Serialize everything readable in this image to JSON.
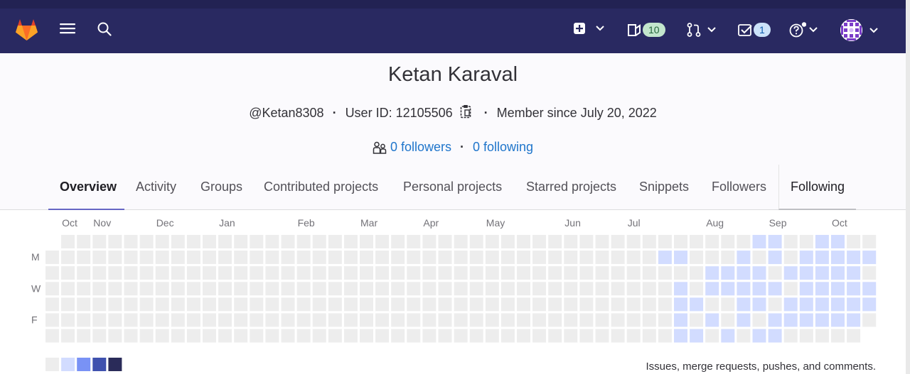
{
  "nav": {
    "todos_count": "10",
    "mr_count": "1"
  },
  "profile": {
    "name": "Ketan Karaval",
    "username": "@Ketan8308",
    "user_id": "User ID: 12105506",
    "member_since": "Member since July 20, 2022",
    "followers": "0 followers",
    "following": "0 following"
  },
  "tabs": [
    {
      "label": "Overview",
      "active": true
    },
    {
      "label": "Activity"
    },
    {
      "label": "Groups"
    },
    {
      "label": "Contributed projects"
    },
    {
      "label": "Personal projects"
    },
    {
      "label": "Starred projects"
    },
    {
      "label": "Snippets"
    },
    {
      "label": "Followers"
    },
    {
      "label": "Following"
    }
  ],
  "calendar": {
    "months": [
      "Oct",
      "Nov",
      "Dec",
      "Jan",
      "Feb",
      "Mar",
      "Apr",
      "May",
      "Jun",
      "Jul",
      "Aug",
      "Sep",
      "Oct"
    ],
    "day_labels": [
      "M",
      "W",
      "F"
    ],
    "caption": "Issues, merge requests, pushes, and comments.",
    "colors": {
      "empty": "#ededed",
      "level1": "#d2dcff",
      "level2": "#7992f5",
      "level3": "#3f51ae",
      "level4": "#2a2b59"
    },
    "legend_colors": [
      "#ededed",
      "#d2dcff",
      "#7992f5",
      "#3f51ae",
      "#2a2b59"
    ],
    "active_cells": [
      [
        39,
        1
      ],
      [
        40,
        1
      ],
      [
        40,
        3
      ],
      [
        40,
        4
      ],
      [
        40,
        5
      ],
      [
        40,
        6
      ],
      [
        41,
        4
      ],
      [
        41,
        6
      ],
      [
        42,
        2
      ],
      [
        42,
        3
      ],
      [
        42,
        5
      ],
      [
        43,
        2
      ],
      [
        43,
        3
      ],
      [
        43,
        6
      ],
      [
        44,
        1
      ],
      [
        44,
        2
      ],
      [
        44,
        3
      ],
      [
        44,
        4
      ],
      [
        44,
        5
      ],
      [
        45,
        0
      ],
      [
        45,
        2
      ],
      [
        45,
        3
      ],
      [
        45,
        4
      ],
      [
        45,
        6
      ],
      [
        46,
        0
      ],
      [
        46,
        1
      ],
      [
        46,
        3
      ],
      [
        46,
        5
      ],
      [
        46,
        6
      ],
      [
        47,
        2
      ],
      [
        47,
        4
      ],
      [
        47,
        5
      ],
      [
        48,
        1
      ],
      [
        48,
        2
      ],
      [
        48,
        3
      ],
      [
        48,
        4
      ],
      [
        48,
        5
      ],
      [
        49,
        0
      ],
      [
        49,
        1
      ],
      [
        49,
        2
      ],
      [
        49,
        3
      ],
      [
        49,
        4
      ],
      [
        49,
        5
      ],
      [
        50,
        0
      ],
      [
        50,
        1
      ],
      [
        50,
        2
      ],
      [
        50,
        3
      ],
      [
        50,
        4
      ],
      [
        50,
        5
      ],
      [
        51,
        1
      ],
      [
        51,
        2
      ],
      [
        51,
        3
      ],
      [
        51,
        4
      ],
      [
        51,
        5
      ],
      [
        52,
        1
      ],
      [
        52,
        3
      ],
      [
        52,
        4
      ],
      [
        52,
        6
      ],
      [
        53,
        1
      ],
      [
        53,
        2
      ]
    ]
  }
}
